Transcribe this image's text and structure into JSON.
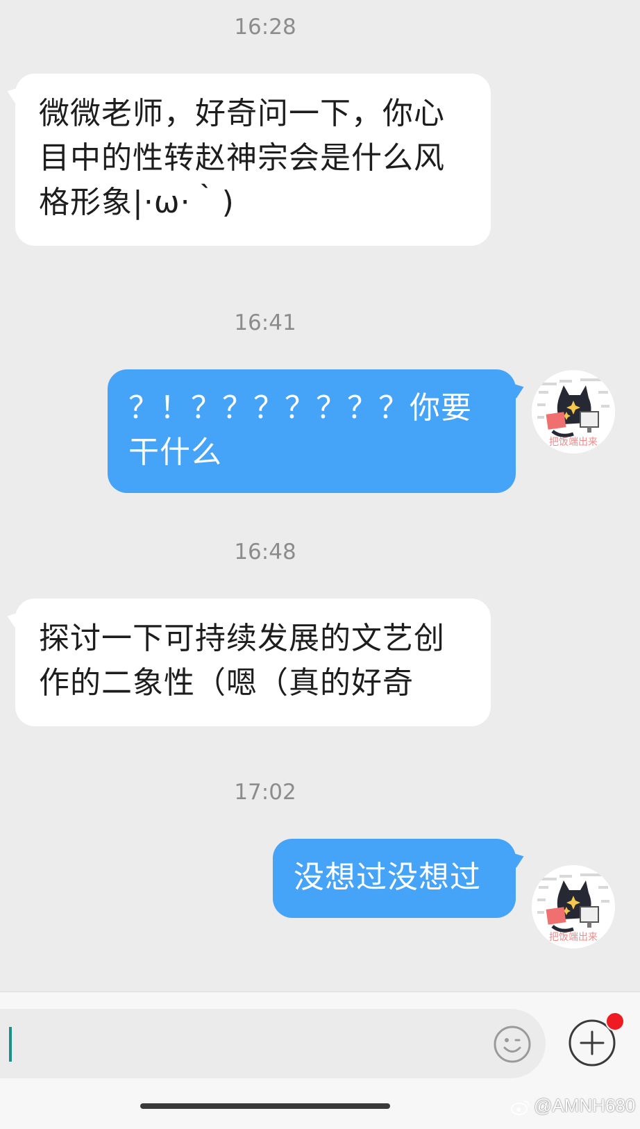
{
  "messages": [
    {
      "time": "16:28",
      "direction": "in",
      "text": "微微老师，好奇问一下，你心目中的性转赵神宗会是什么风格形象|·ω·｀)"
    },
    {
      "time": "16:41",
      "direction": "out",
      "text": "？！？？？？？？？你要干什么"
    },
    {
      "time": "16:48",
      "direction": "in",
      "text": "探讨一下可持续发展的文艺创作的二象性（嗯（真的好奇"
    },
    {
      "time": "17:02",
      "direction": "out",
      "text": "没想过没想过"
    }
  ],
  "input": {
    "value": "",
    "placeholder": ""
  },
  "icons": {
    "emoji": "smiley-icon",
    "plus": "plus-circle-icon",
    "badge": "red-dot-badge"
  },
  "colors": {
    "background": "#ececec",
    "incoming_bubble": "#ffffff",
    "outgoing_bubble": "#45a3f8",
    "caret": "#19908a",
    "badge": "#ee1c22"
  },
  "watermark": "@AMNH680"
}
